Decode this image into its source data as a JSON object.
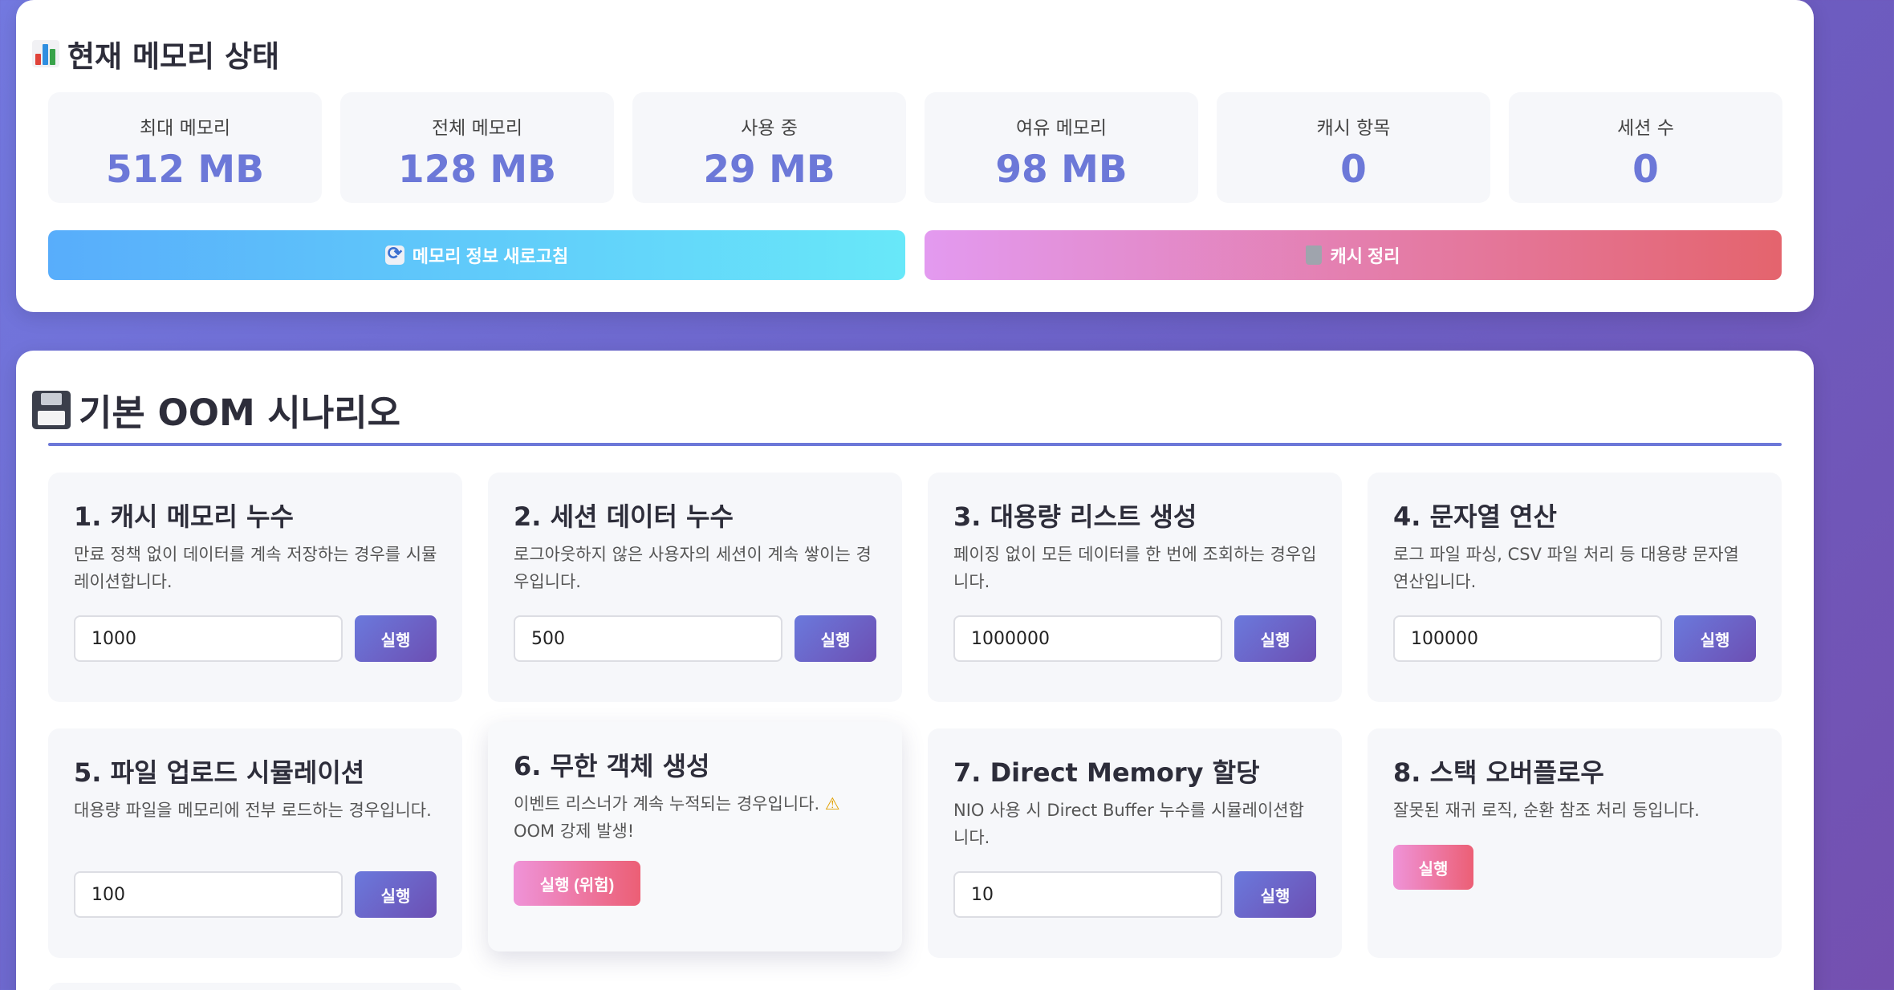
{
  "status": {
    "title": "현재 메모리 상태",
    "stats": [
      {
        "label": "최대 메모리",
        "value": "512 MB"
      },
      {
        "label": "전체 메모리",
        "value": "128 MB"
      },
      {
        "label": "사용 중",
        "value": "29 MB"
      },
      {
        "label": "여유 메모리",
        "value": "98 MB"
      },
      {
        "label": "캐시 항목",
        "value": "0"
      },
      {
        "label": "세션 수",
        "value": "0"
      }
    ],
    "refresh_label": "메모리 정보 새로고침",
    "clear_label": "캐시 정리"
  },
  "scenarios": {
    "title": "기본 OOM 시나리오",
    "items": [
      {
        "title": "1. 캐시 메모리 누수",
        "desc": "만료 정책 없이 데이터를 계속 저장하는 경우를 시뮬레이션합니다.",
        "value": "1000",
        "run": "실행"
      },
      {
        "title": "2. 세션 데이터 누수",
        "desc": "로그아웃하지 않은 사용자의 세션이 계속 쌓이는 경우입니다.",
        "value": "500",
        "run": "실행"
      },
      {
        "title": "3. 대용량 리스트 생성",
        "desc": "페이징 없이 모든 데이터를 한 번에 조회하는 경우입니다.",
        "value": "1000000",
        "run": "실행"
      },
      {
        "title": "4. 문자열 연산",
        "desc": "로그 파일 파싱, CSV 파일 처리 등 대용량 문자열 연산입니다.",
        "value": "100000",
        "run": "실행"
      },
      {
        "title": "5. 파일 업로드 시뮬레이션",
        "desc": "대용량 파일을 메모리에 전부 로드하는 경우입니다.",
        "value": "100",
        "run": "실행"
      },
      {
        "title": "6. 무한 객체 생성",
        "desc": "이벤트 리스너가 계속 누적되는 경우입니다.",
        "desc_extra": "OOM 강제 발생!",
        "run": "실행 (위험)"
      },
      {
        "title": "7. Direct Memory 할당",
        "desc": "NIO 사용 시 Direct Buffer 누수를 시뮬레이션합니다.",
        "value": "10",
        "run": "실행"
      },
      {
        "title": "8. 스택 오버플로우",
        "desc": "잘못된 재귀 로직, 순환 참조 처리 등입니다.",
        "run": "실행"
      }
    ]
  },
  "colors": {
    "accent": "#6c78d8",
    "danger": "#ec5f75"
  },
  "icons": {
    "status": "bar-chart-icon",
    "scenarios": "floppy-disk-icon",
    "refresh": "refresh-icon",
    "clear": "trash-icon",
    "warning": "warning-icon"
  }
}
